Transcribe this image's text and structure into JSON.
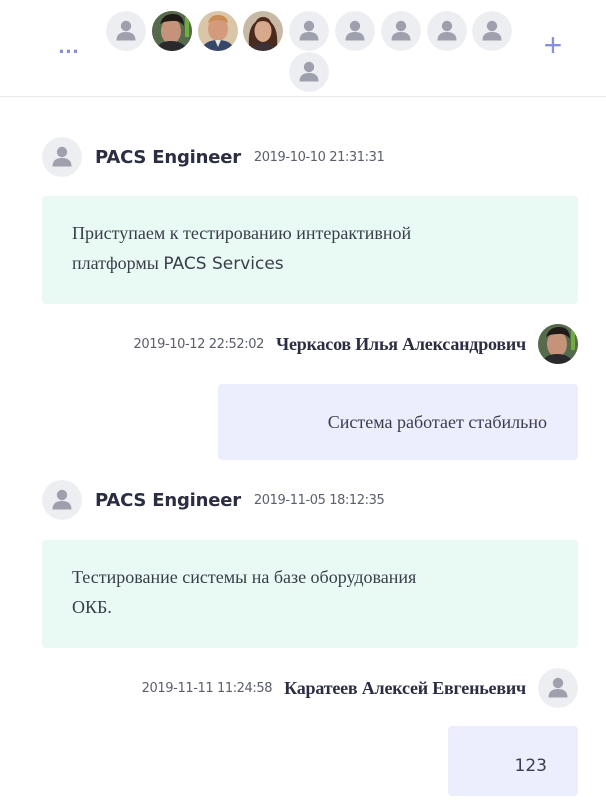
{
  "header": {
    "more_label": "…",
    "add_label": "+",
    "participants": [
      {
        "type": "placeholder"
      },
      {
        "type": "photo",
        "variant": "dark-hair-man"
      },
      {
        "type": "photo",
        "variant": "older-man"
      },
      {
        "type": "photo",
        "variant": "woman"
      },
      {
        "type": "placeholder"
      },
      {
        "type": "placeholder"
      },
      {
        "type": "placeholder"
      },
      {
        "type": "placeholder"
      },
      {
        "type": "placeholder"
      },
      {
        "type": "placeholder"
      }
    ]
  },
  "messages": [
    {
      "direction": "incoming",
      "sender": "PACS Engineer",
      "timestamp": "2019-10-10 21:31:31",
      "text_line1": "Приступаем к тестированию интерактивной",
      "text_line2_prefix": "платформы ",
      "text_line2_highlight": "PACS Services"
    },
    {
      "direction": "outgoing",
      "sender": "Черкасов Илья Александрович",
      "timestamp": "2019-10-12 22:52:02",
      "text": "Система работает стабильно"
    },
    {
      "direction": "incoming",
      "sender": "PACS Engineer",
      "timestamp": "2019-11-05 18:12:35",
      "text_line1": "Тестирование системы на базе оборудования",
      "text_line2": "ОКБ."
    },
    {
      "direction": "outgoing",
      "sender": "Каратеев Алексей Евгеньевич",
      "timestamp": "2019-11-11 11:24:58",
      "text": "123"
    }
  ],
  "colors": {
    "accent": "#8b8fd8",
    "incoming_bubble": "#e9f9f4",
    "outgoing_bubble": "#eceefd",
    "placeholder_bg": "#edeef2",
    "placeholder_fg": "#9ea1ad"
  }
}
